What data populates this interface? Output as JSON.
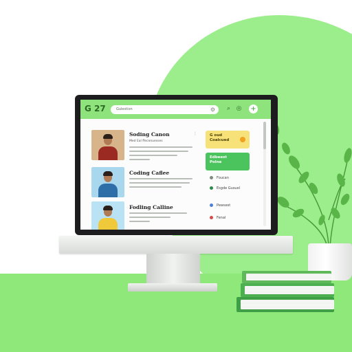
{
  "app": {
    "logo": "G 27",
    "search_placeholder": "Gulestion",
    "accent": "#8fe37d"
  },
  "icons": {
    "search": "search-icon",
    "notification": "gear-icon",
    "filter": "filter-icon",
    "add": "plus-icon"
  },
  "cards": [
    {
      "title": "Soding Canon",
      "subtitle": "Med Eal ffecenuesses",
      "thumb_colors": [
        "#d8b48a",
        "#9b2b22"
      ]
    },
    {
      "title": "Coding Caflee",
      "subtitle": "",
      "thumb_colors": [
        "#a9d7ee",
        "#2d6ea8"
      ]
    },
    {
      "title": "Fodling Calline",
      "subtitle": "",
      "thumb_colors": [
        "#b9e3f4",
        "#f0c93a"
      ]
    }
  ],
  "sidebar": {
    "pill_yellow": {
      "text": "G oud\nCoalcued",
      "color": "#f7e27a",
      "dot": "#f0a21e"
    },
    "pill_green": {
      "text": "Edbeest\nPolne",
      "color": "#4cc45e",
      "dot": "#ffffff"
    },
    "items": [
      {
        "label": "Foucan",
        "dot": "#7f8c7f"
      },
      {
        "label": "Esgde Gusuel",
        "dot": "#2c8a4a"
      },
      {
        "label": "Pewsest",
        "dot": "#4d7fd6"
      },
      {
        "label": "Fenal",
        "dot": "#d94a4a"
      }
    ]
  }
}
